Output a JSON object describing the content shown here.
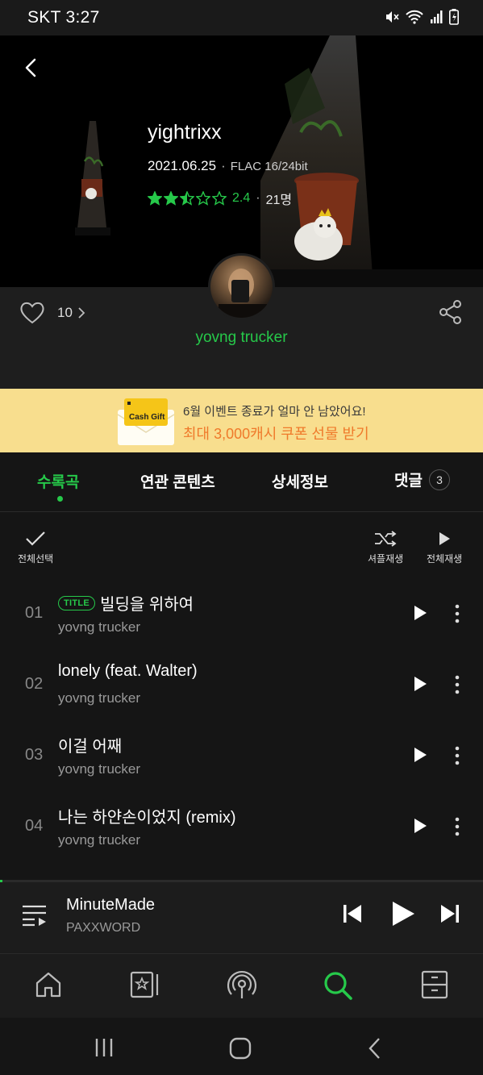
{
  "status_bar": {
    "carrier_time": "SKT 3:27",
    "icons": [
      "mute-icon",
      "wifi-icon",
      "signal-icon",
      "battery-icon"
    ]
  },
  "album": {
    "title": "yightrixx",
    "date": "2021.06.25",
    "format": "FLAC 16/24bit",
    "rating_value": "2.4",
    "rating_count": "21명",
    "rating_stars": 2.5
  },
  "info": {
    "likes": "10",
    "artist": "yovng trucker"
  },
  "banner": {
    "line1": "6월 이벤트 종료가 얼마 안 남았어요!",
    "line2": "최대 3,000캐시 쿠폰 선물 받기",
    "card_label": "Cash Gift"
  },
  "tabs": [
    {
      "label": "수록곡"
    },
    {
      "label": "연관 콘텐츠"
    },
    {
      "label": "상세정보"
    },
    {
      "label": "댓글",
      "badge": "3"
    }
  ],
  "toolbar": {
    "select_all": "전체선택",
    "shuffle": "셔플재생",
    "play_all": "전체재생"
  },
  "tracks": [
    {
      "no": "01",
      "tag": "TITLE",
      "title": "빌딩을 위하여",
      "artist": "yovng trucker"
    },
    {
      "no": "02",
      "title": "lonely (feat. Walter)",
      "artist": "yovng trucker"
    },
    {
      "no": "03",
      "title": "이걸 어째",
      "artist": "yovng trucker"
    },
    {
      "no": "04",
      "title": "나는 하얀손이었지 (remix)",
      "artist": "yovng trucker"
    }
  ],
  "player": {
    "title": "MinuteMade",
    "artist": "PAXXWORD",
    "progress": 0.005
  },
  "colors": {
    "accent": "#26c94a",
    "background": "#151515",
    "banner": "#f8de8e",
    "banner_highlight": "#ef7a2b"
  },
  "nav_icons": [
    "home-icon",
    "library-icon",
    "podcast-icon",
    "search-icon",
    "storage-icon"
  ]
}
